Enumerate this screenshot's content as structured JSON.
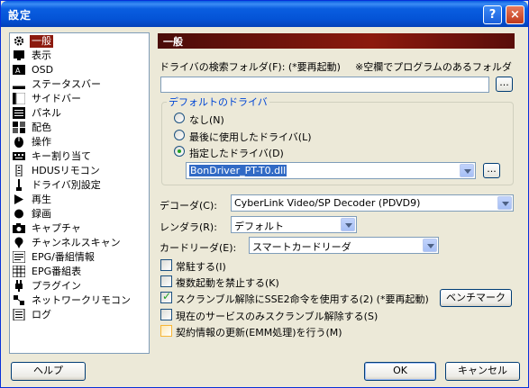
{
  "window": {
    "title": "設定",
    "help_glyph": "?",
    "close_glyph": "×"
  },
  "sidebar": {
    "items": [
      {
        "label": "一般",
        "icon": "gear-icon",
        "selected": true
      },
      {
        "label": "表示",
        "icon": "monitor-icon"
      },
      {
        "label": "OSD",
        "icon": "osd-icon"
      },
      {
        "label": "ステータスバー",
        "icon": "statusbar-icon"
      },
      {
        "label": "サイドバー",
        "icon": "sidebar-icon"
      },
      {
        "label": "パネル",
        "icon": "panel-icon"
      },
      {
        "label": "配色",
        "icon": "color-grid-icon"
      },
      {
        "label": "操作",
        "icon": "mouse-icon"
      },
      {
        "label": "キー割り当て",
        "icon": "keyboard-icon"
      },
      {
        "label": "HDUSリモコン",
        "icon": "remote-icon"
      },
      {
        "label": "ドライバ別設定",
        "icon": "driver-icon"
      },
      {
        "label": "再生",
        "icon": "play-icon"
      },
      {
        "label": "録画",
        "icon": "record-icon"
      },
      {
        "label": "キャプチャ",
        "icon": "camera-icon"
      },
      {
        "label": "チャンネルスキャン",
        "icon": "scan-icon"
      },
      {
        "label": "EPG/番組情報",
        "icon": "epg-icon"
      },
      {
        "label": "EPG番組表",
        "icon": "epg-table-icon"
      },
      {
        "label": "プラグイン",
        "icon": "plugin-icon"
      },
      {
        "label": "ネットワークリモコン",
        "icon": "network-icon"
      },
      {
        "label": "ログ",
        "icon": "log-icon"
      }
    ]
  },
  "main": {
    "header": "一般",
    "driver_folder": {
      "label": "ドライバの検索フォルダ(F): (*要再起動)",
      "hint": "※空欄でプログラムのあるフォルダ",
      "value": "",
      "browse_label": "..."
    },
    "default_driver": {
      "group_title": "デフォルトのドライバ",
      "options": [
        {
          "label": "なし(N)",
          "checked": false
        },
        {
          "label": "最後に使用したドライバ(L)",
          "checked": false
        },
        {
          "label": "指定したドライバ(D)",
          "checked": true
        }
      ],
      "driver_value": "BonDriver_PT-T0.dll",
      "browse_label": "..."
    },
    "decoder": {
      "label": "デコーダ(C):",
      "value": "CyberLink Video/SP Decoder (PDVD9)"
    },
    "renderer": {
      "label": "レンダラ(R):",
      "value": "デフォルト"
    },
    "card_reader": {
      "label": "カードリーダ(E):",
      "value": "スマートカードリーダ"
    },
    "checkboxes": [
      {
        "label": "常駐する(I)",
        "checked": false
      },
      {
        "label": "複数起動を禁止する(K)",
        "checked": false
      },
      {
        "label": "スクランブル解除にSSE2命令を使用する(2) (*要再起動)",
        "checked": true
      },
      {
        "label": "現在のサービスのみスクランブル解除する(S)",
        "checked": false
      },
      {
        "label": "契約情報の更新(EMM処理)を行う(M)",
        "checked": false
      }
    ],
    "benchmark_label": "ベンチマーク"
  },
  "footer": {
    "help_label": "ヘルプ",
    "ok_label": "OK",
    "cancel_label": "キャンセル"
  }
}
